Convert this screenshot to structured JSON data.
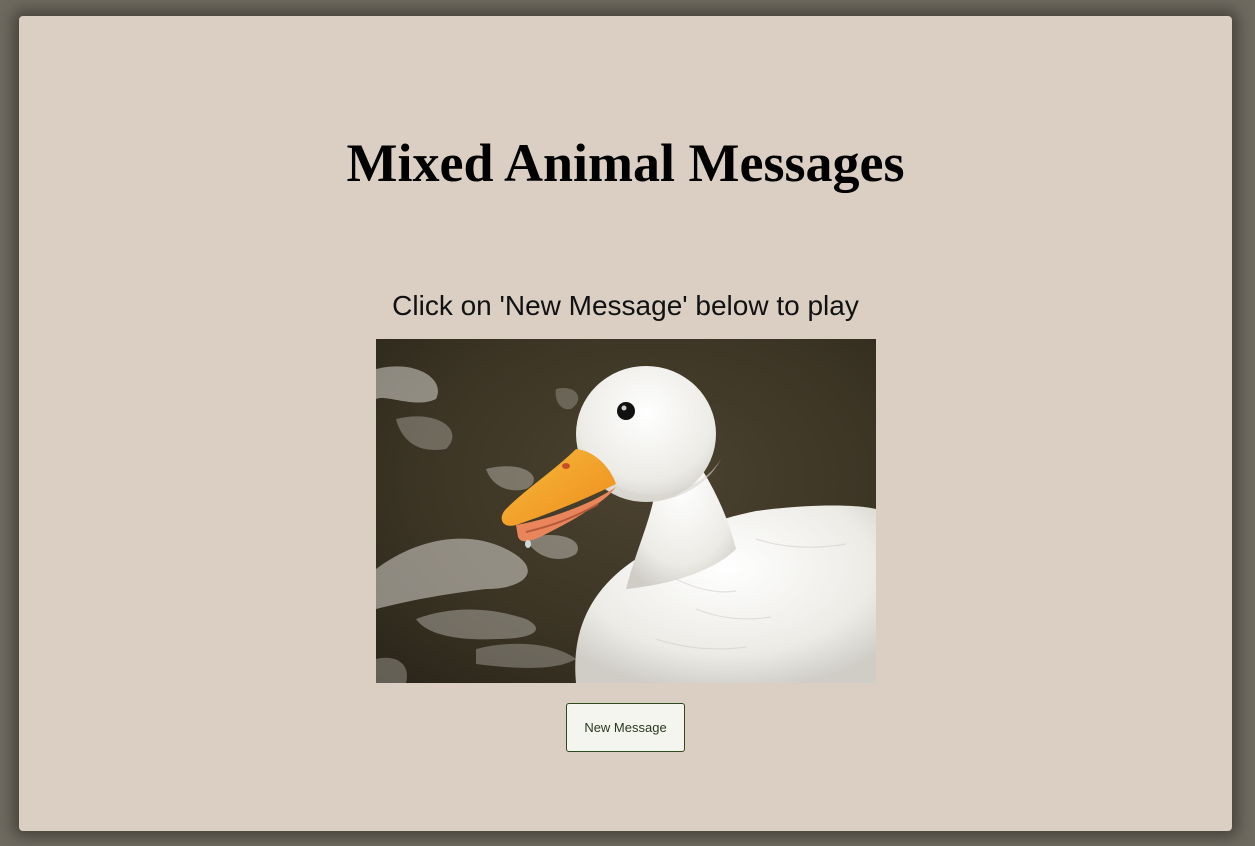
{
  "page": {
    "title": "Mixed Animal Messages",
    "instruction": "Click on 'New Message' below to play"
  },
  "image": {
    "subject": "white duck with orange bill on dark water",
    "alt": "White duck"
  },
  "controls": {
    "new_message_label": "New Message"
  },
  "colors": {
    "page_background": "#6e6a60",
    "card_background": "#dbcfc3",
    "button_background": "#f4f5ef",
    "button_border": "#2c4a1e",
    "button_text": "#2a3a22"
  }
}
